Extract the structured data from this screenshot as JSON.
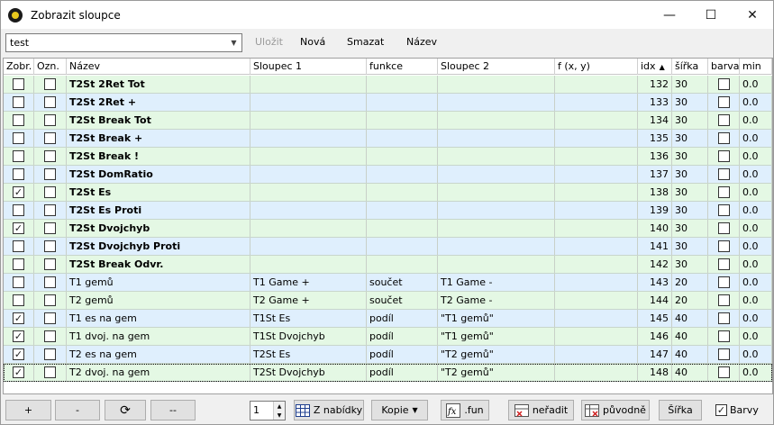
{
  "window": {
    "title": "Zobrazit sloupce",
    "minimize": "—",
    "maximize": "☐",
    "close": "✕"
  },
  "toolbar": {
    "preset": "test",
    "save": "Uložit",
    "new": "Nová",
    "delete": "Smazat",
    "rename": "Název"
  },
  "columns": [
    "Zobr.",
    "Ozn.",
    "Název",
    "Sloupec 1",
    "funkce",
    "Sloupec 2",
    "f (x, y)",
    "idx",
    "šířka",
    "barva",
    "min"
  ],
  "rows": [
    {
      "show": false,
      "mark": false,
      "name": "T2St 2Ret Tot",
      "bold": true,
      "col1": "",
      "func": "",
      "col2": "",
      "fxy": "",
      "idx": "132",
      "width": "30",
      "color": false,
      "min": "0.0"
    },
    {
      "show": false,
      "mark": false,
      "name": "T2St 2Ret +",
      "bold": true,
      "col1": "",
      "func": "",
      "col2": "",
      "fxy": "",
      "idx": "133",
      "width": "30",
      "color": false,
      "min": "0.0"
    },
    {
      "show": false,
      "mark": false,
      "name": "T2St Break Tot",
      "bold": true,
      "col1": "",
      "func": "",
      "col2": "",
      "fxy": "",
      "idx": "134",
      "width": "30",
      "color": false,
      "min": "0.0"
    },
    {
      "show": false,
      "mark": false,
      "name": "T2St Break +",
      "bold": true,
      "col1": "",
      "func": "",
      "col2": "",
      "fxy": "",
      "idx": "135",
      "width": "30",
      "color": false,
      "min": "0.0"
    },
    {
      "show": false,
      "mark": false,
      "name": "T2St Break !",
      "bold": true,
      "col1": "",
      "func": "",
      "col2": "",
      "fxy": "",
      "idx": "136",
      "width": "30",
      "color": false,
      "min": "0.0"
    },
    {
      "show": false,
      "mark": false,
      "name": "T2St DomRatio",
      "bold": true,
      "col1": "",
      "func": "",
      "col2": "",
      "fxy": "",
      "idx": "137",
      "width": "30",
      "color": false,
      "min": "0.0"
    },
    {
      "show": true,
      "mark": false,
      "name": "T2St Es",
      "bold": true,
      "col1": "",
      "func": "",
      "col2": "",
      "fxy": "",
      "idx": "138",
      "width": "30",
      "color": false,
      "min": "0.0"
    },
    {
      "show": false,
      "mark": false,
      "name": "T2St Es Proti",
      "bold": true,
      "col1": "",
      "func": "",
      "col2": "",
      "fxy": "",
      "idx": "139",
      "width": "30",
      "color": false,
      "min": "0.0"
    },
    {
      "show": true,
      "mark": false,
      "name": "T2St Dvojchyb",
      "bold": true,
      "col1": "",
      "func": "",
      "col2": "",
      "fxy": "",
      "idx": "140",
      "width": "30",
      "color": false,
      "min": "0.0"
    },
    {
      "show": false,
      "mark": false,
      "name": "T2St Dvojchyb Proti",
      "bold": true,
      "col1": "",
      "func": "",
      "col2": "",
      "fxy": "",
      "idx": "141",
      "width": "30",
      "color": false,
      "min": "0.0"
    },
    {
      "show": false,
      "mark": false,
      "name": "T2St Break Odvr.",
      "bold": true,
      "col1": "",
      "func": "",
      "col2": "",
      "fxy": "",
      "idx": "142",
      "width": "30",
      "color": false,
      "min": "0.0"
    },
    {
      "show": false,
      "mark": false,
      "name": "T1 gemů",
      "bold": false,
      "col1": "T1 Game +",
      "func": "součet",
      "col2": "T1 Game -",
      "fxy": "",
      "idx": "143",
      "width": "20",
      "color": false,
      "min": "0.0"
    },
    {
      "show": false,
      "mark": false,
      "name": "T2 gemů",
      "bold": false,
      "col1": "T2 Game +",
      "func": "součet",
      "col2": "T2 Game -",
      "fxy": "",
      "idx": "144",
      "width": "20",
      "color": false,
      "min": "0.0"
    },
    {
      "show": true,
      "mark": false,
      "name": "T1 es na gem",
      "bold": false,
      "col1": "T1St Es",
      "func": "podíl",
      "col2": "\"T1 gemů\"",
      "fxy": "",
      "idx": "145",
      "width": "40",
      "color": false,
      "min": "0.0"
    },
    {
      "show": true,
      "mark": false,
      "name": "T1 dvoj. na gem",
      "bold": false,
      "col1": "T1St Dvojchyb",
      "func": "podíl",
      "col2": "\"T1 gemů\"",
      "fxy": "",
      "idx": "146",
      "width": "40",
      "color": false,
      "min": "0.0"
    },
    {
      "show": true,
      "mark": false,
      "name": "T2 es na gem",
      "bold": false,
      "col1": "T2St Es",
      "func": "podíl",
      "col2": "\"T2 gemů\"",
      "fxy": "",
      "idx": "147",
      "width": "40",
      "color": false,
      "min": "0.0"
    },
    {
      "show": true,
      "mark": false,
      "name": "T2 dvoj. na gem",
      "bold": false,
      "col1": "T2St Dvojchyb",
      "func": "podíl",
      "col2": "\"T2 gemů\"",
      "fxy": "",
      "idx": "148",
      "width": "40",
      "color": false,
      "min": "0.0"
    }
  ],
  "bottom": {
    "add": "+",
    "remove": "-",
    "refresh": "⟳",
    "separator": "--",
    "spin_value": "1",
    "from_menu": "Z nabídky",
    "copy": "Kopie",
    "fun": ".fun",
    "no_sort": "neřadit",
    "original": "původně",
    "width": "Šířka",
    "colors": "Barvy"
  },
  "colors": {
    "row_green": "#e4f8e4",
    "row_blue": "#dfeffd"
  }
}
